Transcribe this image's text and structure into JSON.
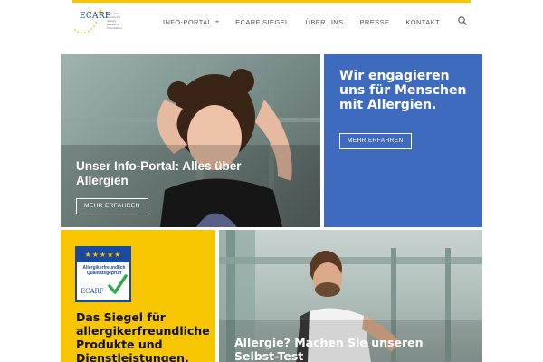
{
  "header": {
    "logo": {
      "word": "ECARF",
      "subtitle_lines": [
        "European",
        "Centre for",
        "Allergy",
        "Research",
        "Foundation"
      ]
    },
    "nav": [
      {
        "label": "INFO-PORTAL",
        "has_dropdown": true
      },
      {
        "label": "ECARF SIEGEL",
        "has_dropdown": false
      },
      {
        "label": "ÜBER UNS",
        "has_dropdown": false
      },
      {
        "label": "PRESSE",
        "has_dropdown": false
      },
      {
        "label": "KONTAKT",
        "has_dropdown": false
      }
    ],
    "search_icon": "search-icon"
  },
  "tiles": {
    "hero": {
      "title": "Unser Info-Portal: Alles über Allergien",
      "button_label": "MEHR ERFAHREN"
    },
    "blue": {
      "title": "Wir engagieren uns für Menschen mit Allergien.",
      "button_label": "MEHR ERFAHREN"
    },
    "seal": {
      "badge_stars": "★★★★★",
      "badge_text": "Allergikerfreundlich Qualitätsgeprüft",
      "badge_logo": "ECARF",
      "title": "Das Siegel für allergikerfreundliche Produkte und Dienstleistungen."
    },
    "test": {
      "title": "Allergie? Machen Sie unseren Selbst-Test"
    }
  },
  "colors": {
    "accent_yellow": "#f7c600",
    "brand_blue": "#3e6bbd",
    "nav_text": "#555555"
  }
}
